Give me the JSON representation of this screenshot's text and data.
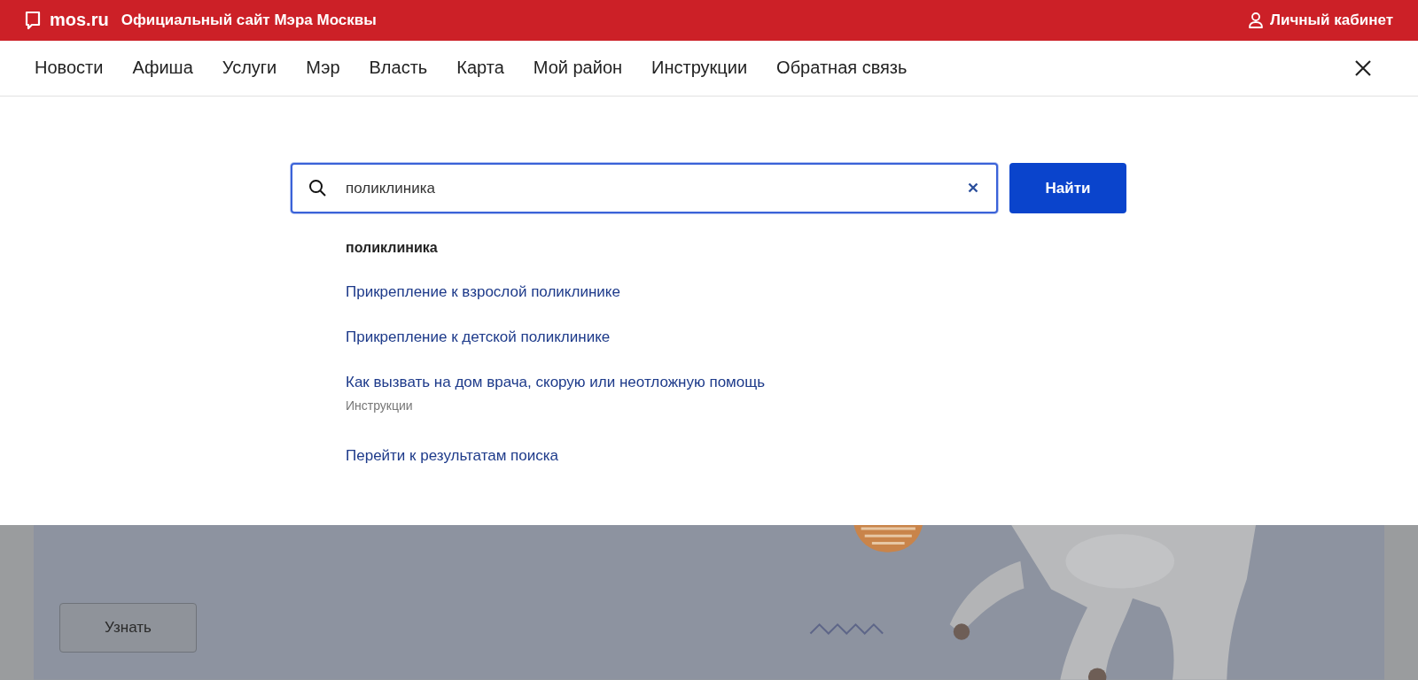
{
  "header": {
    "logo": "mos.ru",
    "site_title": "Официальный сайт Мэра Москвы",
    "account_link": "Личный кабинет"
  },
  "nav": {
    "items": [
      {
        "label": "Новости"
      },
      {
        "label": "Афиша"
      },
      {
        "label": "Услуги"
      },
      {
        "label": "Мэр"
      },
      {
        "label": "Власть"
      },
      {
        "label": "Карта"
      },
      {
        "label": "Мой район"
      },
      {
        "label": "Инструкции"
      },
      {
        "label": "Обратная связь"
      }
    ]
  },
  "search": {
    "value": "поликлиника",
    "button": "Найти"
  },
  "suggestions": [
    {
      "kind": "query",
      "text": "поликлиника"
    },
    {
      "kind": "link",
      "text": "Прикрепление к взрослой поликлинике"
    },
    {
      "kind": "link",
      "text": "Прикрепление к детской поликлинике"
    },
    {
      "kind": "link",
      "text": "Как вызвать на дом врача, скорую или неотложную помощь",
      "category": "Инструкции"
    },
    {
      "kind": "all",
      "text": "Перейти к результатам поиска"
    }
  ],
  "banner": {
    "kind": "picture",
    "button": "Узнать"
  }
}
